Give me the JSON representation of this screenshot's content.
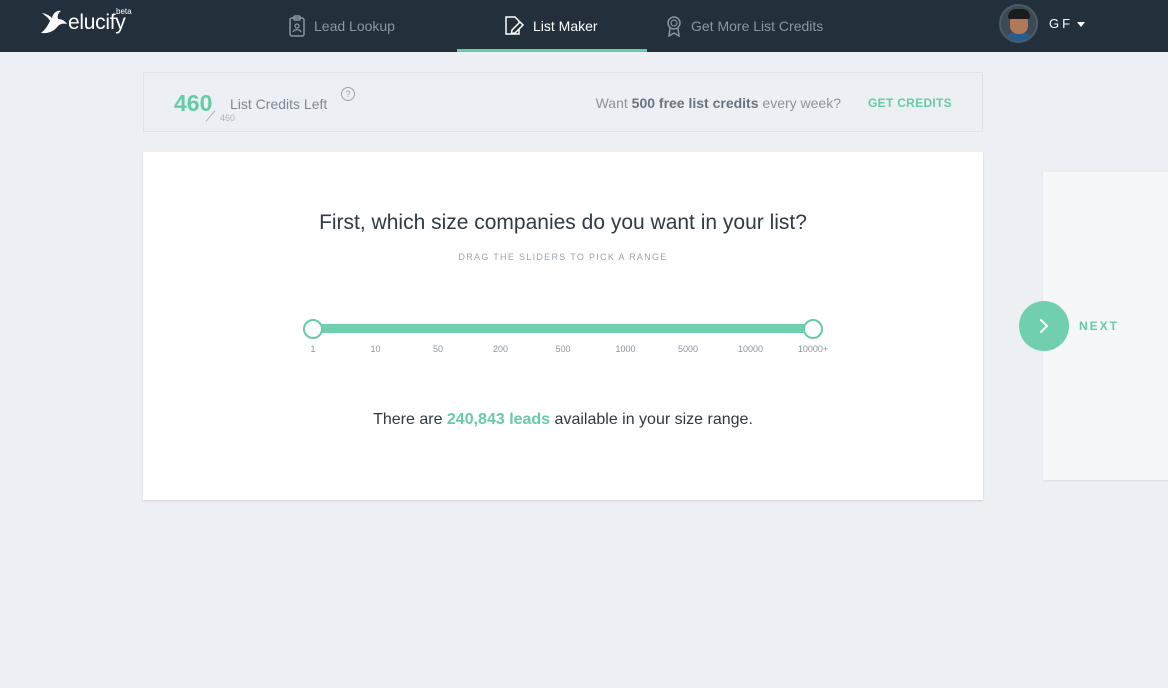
{
  "brand": {
    "name": "elucify",
    "badge": "beta"
  },
  "nav": {
    "items": [
      {
        "label": "Lead Lookup",
        "icon": "clipboard-icon"
      },
      {
        "label": "List Maker",
        "icon": "list-edit-icon",
        "active": true
      },
      {
        "label": "Get More List Credits",
        "icon": "award-icon"
      }
    ]
  },
  "user": {
    "initials": "GF"
  },
  "credits": {
    "remaining": "460",
    "total": "460",
    "label": "List Credits Left",
    "help": "?",
    "promo_prefix": "Want ",
    "promo_bold": "500 free list credits",
    "promo_suffix": " every week?",
    "cta": "GET CREDITS"
  },
  "wizard": {
    "question": "First, which size companies do you want in your list?",
    "hint": "DRAG THE SLIDERS TO PICK A RANGE",
    "slider": {
      "ticks": [
        "1",
        "10",
        "50",
        "200",
        "500",
        "1000",
        "5000",
        "10000",
        "10000+"
      ],
      "selected_min": "1",
      "selected_max": "10000+"
    },
    "result_prefix": "There are ",
    "result_count": "240,843 leads",
    "result_suffix": " available in your size range."
  },
  "next": {
    "label": "NEXT"
  },
  "colors": {
    "accent": "#67cba8",
    "nav_bg": "#232f3b",
    "page_bg": "#ecf0f4"
  }
}
